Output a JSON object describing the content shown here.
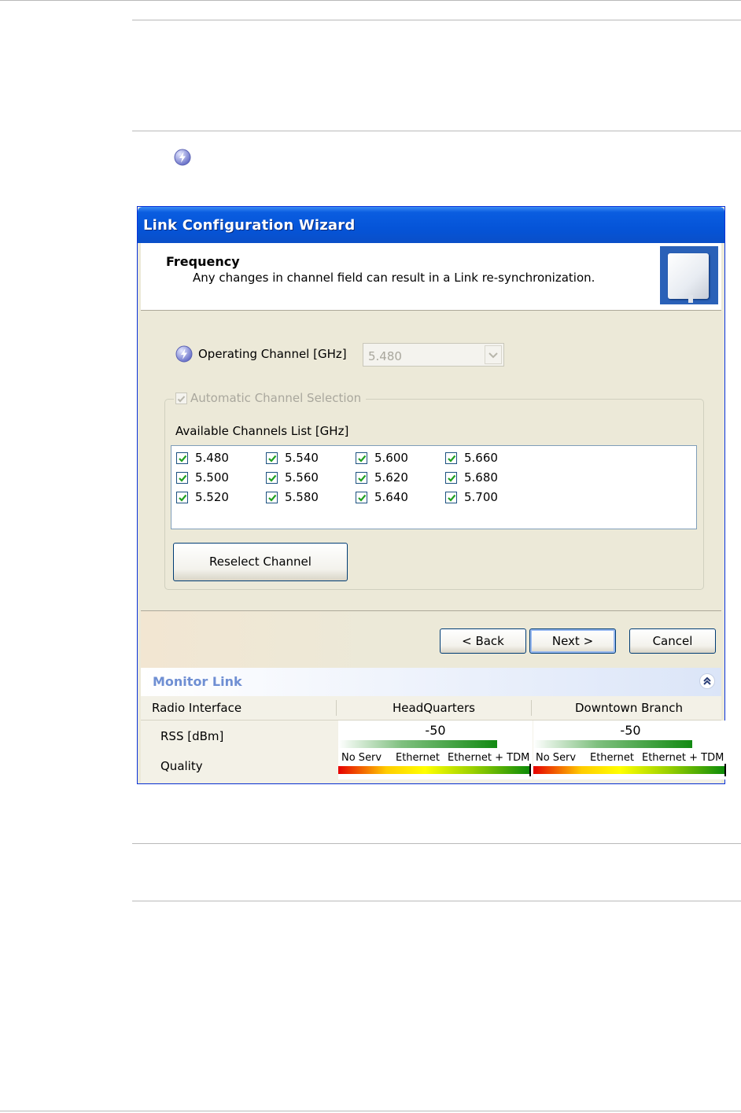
{
  "window": {
    "title": "Link Configuration Wizard"
  },
  "header": {
    "title": "Frequency",
    "subtitle": "Any changes in channel field can result in a Link re-synchronization."
  },
  "operating_channel": {
    "label": "Operating Channel [GHz]",
    "value": "5.480"
  },
  "auto_selection": {
    "label": "Automatic Channel Selection",
    "checked": true
  },
  "available_channels": {
    "label": "Available Channels List [GHz]",
    "items": [
      {
        "value": "5.480",
        "checked": true
      },
      {
        "value": "5.500",
        "checked": true
      },
      {
        "value": "5.520",
        "checked": true
      },
      {
        "value": "5.540",
        "checked": true
      },
      {
        "value": "5.560",
        "checked": true
      },
      {
        "value": "5.580",
        "checked": true
      },
      {
        "value": "5.600",
        "checked": true
      },
      {
        "value": "5.620",
        "checked": true
      },
      {
        "value": "5.640",
        "checked": true
      },
      {
        "value": "5.660",
        "checked": true
      },
      {
        "value": "5.680",
        "checked": true
      },
      {
        "value": "5.700",
        "checked": true
      }
    ]
  },
  "buttons": {
    "reselect": "Reselect Channel",
    "back": "< Back",
    "next": "Next >",
    "cancel": "Cancel"
  },
  "monitor": {
    "title": "Monitor Link",
    "col_label": "Radio Interface",
    "sites": [
      "HeadQuarters",
      "Downtown Branch"
    ],
    "rss_label": "RSS [dBm]",
    "quality_label": "Quality",
    "rss_values": [
      "-50",
      "-50"
    ],
    "quality_scale": [
      "No Serv",
      "Ethernet",
      "Ethernet + TDM"
    ]
  },
  "icons": {
    "operating_channel": "lightning-icon",
    "collapse": "chevron-double-up-icon"
  }
}
